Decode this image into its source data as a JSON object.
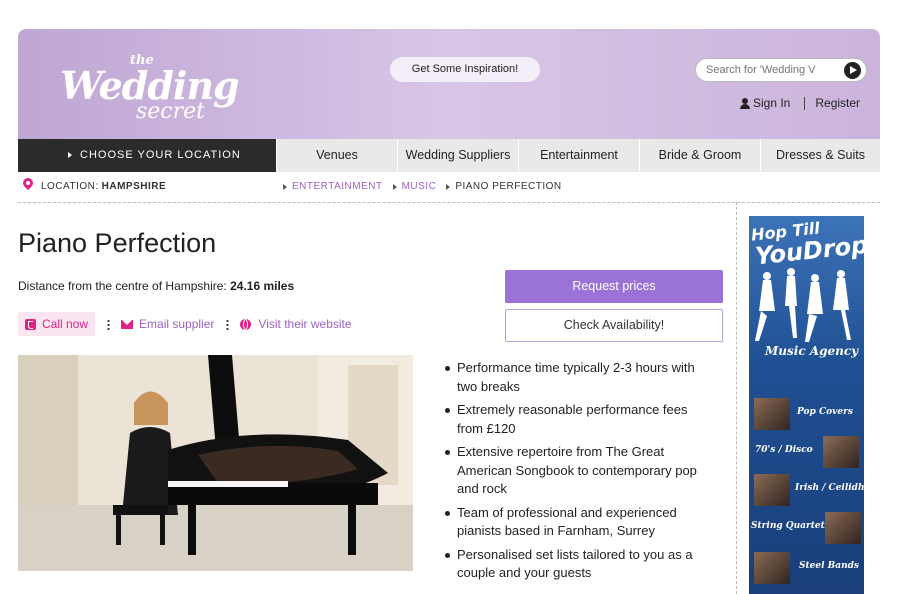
{
  "header": {
    "logo": {
      "the": "the",
      "wedding": "Wedding",
      "secret": "secret"
    },
    "inspiration_button": "Get Some Inspiration!",
    "search_placeholder": "Search for 'Wedding V",
    "sign_in": "Sign In",
    "register": "Register"
  },
  "nav": {
    "location_label": "CHOOSE YOUR LOCATION",
    "items": [
      "Venues",
      "Wedding Suppliers",
      "Entertainment",
      "Bride & Groom",
      "Dresses & Suits"
    ]
  },
  "location": {
    "prefix": "LOCATION:",
    "value": "HAMPSHIRE"
  },
  "breadcrumb": [
    "ENTERTAINMENT",
    "MUSIC",
    "PIANO PERFECTION"
  ],
  "listing": {
    "title": "Piano Perfection",
    "distance_text": "Distance from the centre of Hampshire:",
    "distance_value": "24.16 miles",
    "call_now": "Call now",
    "email_supplier": "Email supplier",
    "visit_website": "Visit their website",
    "request_prices": "Request prices",
    "check_availability": "Check Availability!",
    "features": [
      "Performance time typically 2-3 hours with two breaks",
      "Extremely reasonable performance fees from £120",
      "Extensive repertoire from The Great American Songbook to contemporary pop and rock",
      "Team of professional and experienced pianists based in Farnham, Surrey",
      "Personalised set lists tailored to you as a couple and your guests"
    ]
  },
  "ad": {
    "headline_1": "Hop Till",
    "headline_2": "YouDrop!",
    "agency": "Music Agency",
    "acts": [
      "Pop Covers",
      "70's / Disco",
      "Irish / Ceilidh",
      "String Quartets",
      "Steel Bands"
    ]
  },
  "colors": {
    "header_bg": "#cbb4dc",
    "accent_purple": "#9b72d6",
    "link_purple": "#9a62c4",
    "pink": "#e0218a",
    "nav_dark": "#2b2b2b"
  }
}
